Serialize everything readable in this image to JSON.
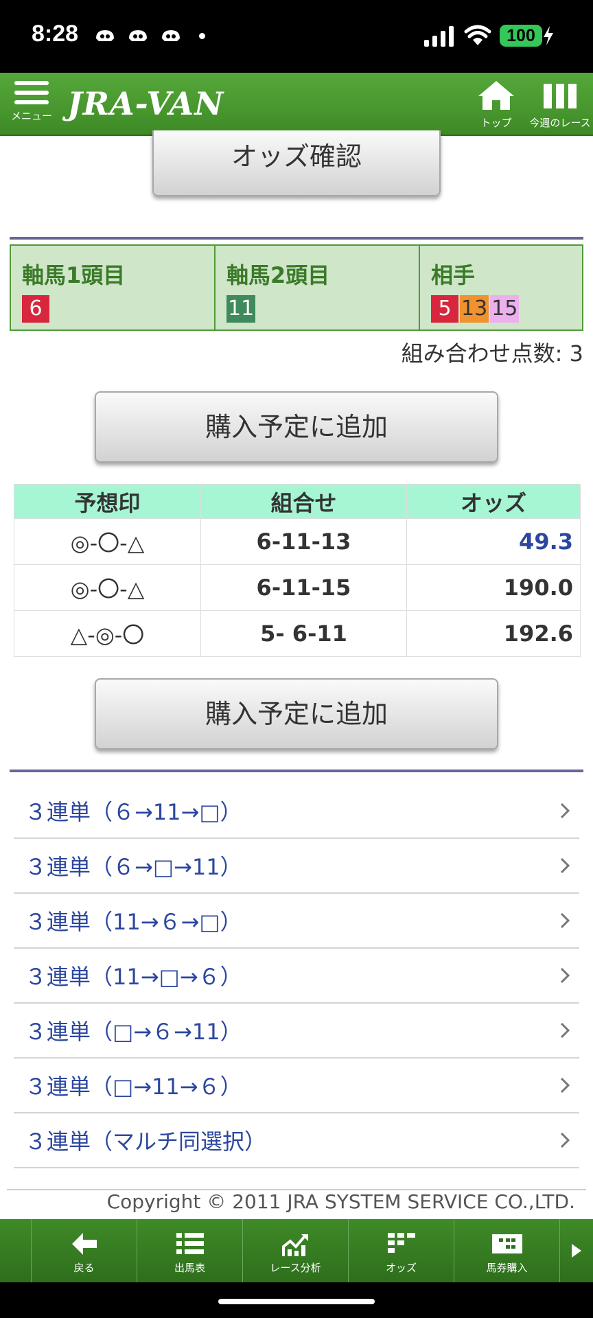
{
  "status_bar": {
    "time": "8:28",
    "battery": "100"
  },
  "header": {
    "menu_label": "メニュー",
    "logo": "JRA-VAN",
    "top_label": "トップ",
    "week_label": "今週のレース"
  },
  "odds_check_button": "オッズ確認",
  "selection": {
    "columns": [
      {
        "title": "軸馬1頭目",
        "horses": [
          {
            "num": "6",
            "bg": "#d7263d",
            "fg": "#ffffff"
          }
        ]
      },
      {
        "title": "軸馬2頭目",
        "horses": [
          {
            "num": "11",
            "bg": "#3e8a5c",
            "fg": "#ffffff"
          }
        ]
      },
      {
        "title": "相手",
        "horses": [
          {
            "num": "5",
            "bg": "#d7263d",
            "fg": "#ffffff"
          },
          {
            "num": "13",
            "bg": "#f0922e",
            "fg": "#333333"
          },
          {
            "num": "15",
            "bg": "#ecb0ec",
            "fg": "#333333"
          }
        ]
      }
    ]
  },
  "combo_count": "組み合わせ点数: 3",
  "add_button_label": "購入予定に追加",
  "odds_table": {
    "headers": [
      "予想印",
      "組合せ",
      "オッズ"
    ],
    "rows": [
      {
        "mark": "◎-〇-△",
        "combo": "6-11-13",
        "odds": "49.3",
        "odds_color": "#2c47a0"
      },
      {
        "mark": "◎-〇-△",
        "combo": "6-11-15",
        "odds": "190.0",
        "odds_color": "#333333"
      },
      {
        "mark": "△-◎-〇",
        "combo": "5- 6-11",
        "odds": "192.6",
        "odds_color": "#333333"
      }
    ]
  },
  "bet_links": [
    "３連単（６→11→□）",
    "３連単（６→□→11）",
    "３連単（11→６→□）",
    "３連単（11→□→６）",
    "３連単（□→６→11）",
    "３連単（□→11→６）",
    "３連単（マルチ同選択）"
  ],
  "copyright": "Copyright © 2011 JRA SYSTEM SERVICE CO.,LTD.",
  "bottom_nav": {
    "back": "戻る",
    "entries": "出馬表",
    "analysis": "レース分析",
    "odds": "オッズ",
    "purchase": "馬券購入"
  }
}
